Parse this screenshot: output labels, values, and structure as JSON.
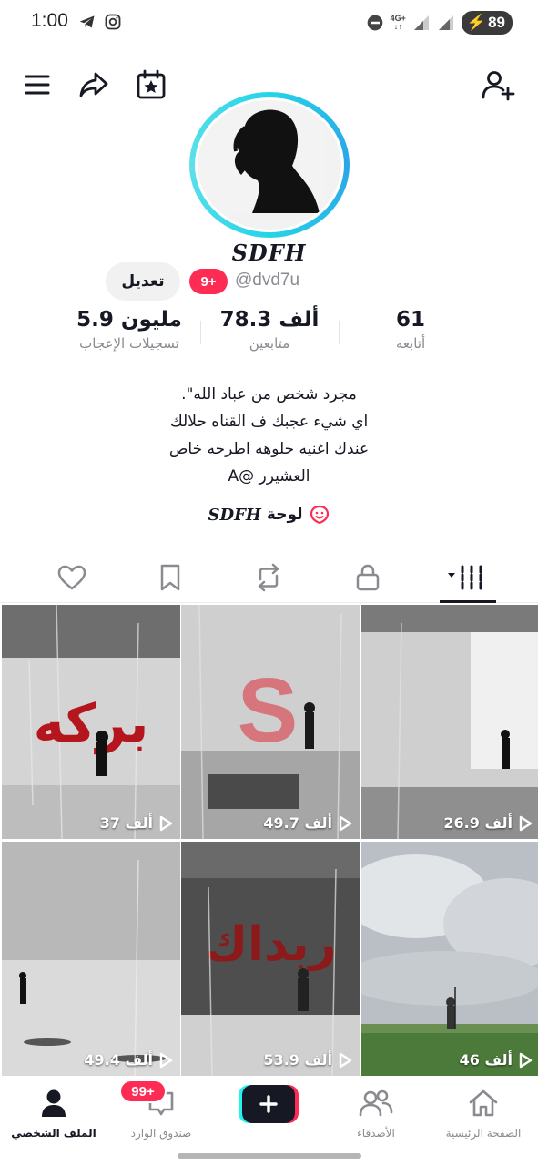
{
  "status_bar": {
    "time": "1:00",
    "network": "4G+",
    "battery": "89",
    "icons": [
      "telegram-icon",
      "instagram-icon",
      "dnd-icon",
      "signal-icon",
      "battery-icon"
    ]
  },
  "top_bar": {
    "icons": [
      "menu-icon",
      "share-icon",
      "calendar-star-icon",
      "add-friend-icon"
    ]
  },
  "profile": {
    "display_name": "SDFH",
    "username": "@dvd7u",
    "badge": "9+",
    "edit_label": "تعديل",
    "ring_colors": [
      "#25d4e8",
      "#2aa5e8"
    ]
  },
  "stats": {
    "likes": {
      "value": "5.9 مليون",
      "label": "تسجيلات الإعجاب"
    },
    "followers": {
      "value": "78.3 ألف",
      "label": "متابعين"
    },
    "following": {
      "value": "61",
      "label": "أتابعه"
    }
  },
  "bio": {
    "lines": [
      "مجرد شخص من عباد الله\".",
      "اي شيء عجبك ف القناه حلالك",
      "عندك اغنيه حلوهه اطرحه خاص",
      "العشيرر @A"
    ]
  },
  "playlist": {
    "label": "لوحة",
    "name": "SDFH"
  },
  "tabs": [
    "videos-tab",
    "private-tab",
    "reposts-tab",
    "favorites-tab",
    "liked-tab"
  ],
  "videos": [
    {
      "views": "37 ألف",
      "overlay_text": "بركه"
    },
    {
      "views": "49.7 ألف",
      "overlay_text": "S"
    },
    {
      "views": "26.9 ألف",
      "overlay_text": ""
    },
    {
      "views": "49.4 ألف",
      "overlay_text": ""
    },
    {
      "views": "53.9 ألف",
      "overlay_text": "ربداك"
    },
    {
      "views": "46 ألف",
      "overlay_text": ""
    }
  ],
  "bottom_nav": {
    "profile": "الملف الشخصي",
    "inbox": "صندوق الوارد",
    "inbox_badge": "99+",
    "create": "+",
    "friends": "الأصدقاء",
    "home": "الصفحة الرئيسية"
  },
  "colors": {
    "accent": "#fe2c55",
    "cyan": "#25f4ee",
    "text": "#161823",
    "muted": "#8a8b91"
  }
}
